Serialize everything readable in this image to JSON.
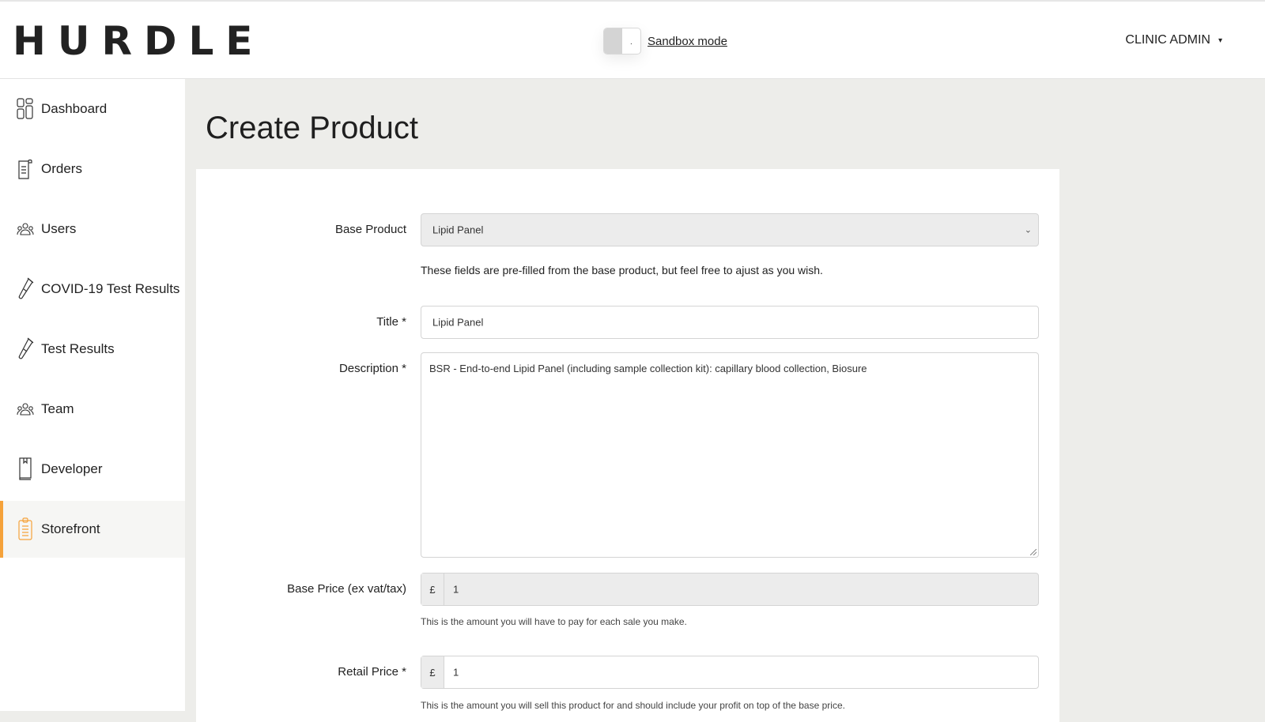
{
  "header": {
    "logo": "HURDLE",
    "sandbox_label": "Sandbox mode",
    "sandbox_toggle_glyph": ".",
    "user_menu_label": "CLINIC ADMIN",
    "user_menu_caret": "▾"
  },
  "sidebar": {
    "items": [
      {
        "label": "Dashboard",
        "icon": "dashboard-icon"
      },
      {
        "label": "Orders",
        "icon": "orders-icon"
      },
      {
        "label": "Users",
        "icon": "users-icon"
      },
      {
        "label": "COVID-19 Test Results",
        "icon": "test-tube-icon"
      },
      {
        "label": "Test Results",
        "icon": "test-tube-icon"
      },
      {
        "label": "Team",
        "icon": "team-icon"
      },
      {
        "label": "Developer",
        "icon": "book-icon"
      },
      {
        "label": "Storefront",
        "icon": "clipboard-icon",
        "active": true
      }
    ],
    "accent_color": "#f5a23a"
  },
  "main": {
    "title": "Create Product",
    "form": {
      "base_product": {
        "label": "Base Product",
        "value": "Lipid Panel"
      },
      "prefill_note": "These fields are pre-filled from the base product, but feel free to ajust as you wish.",
      "title": {
        "label": "Title *",
        "value": "Lipid Panel"
      },
      "description": {
        "label": "Description *",
        "value": "BSR - End-to-end Lipid Panel (including sample collection kit): capillary blood collection, Biosure"
      },
      "base_price": {
        "label": "Base Price (ex vat/tax)",
        "currency": "£",
        "value": "1",
        "help": "This is the amount you will have to pay for each sale you make."
      },
      "retail_price": {
        "label": "Retail Price *",
        "currency": "£",
        "value": "1",
        "help": "This is the amount you will sell this product for and should include your profit on top of the base price."
      }
    }
  }
}
